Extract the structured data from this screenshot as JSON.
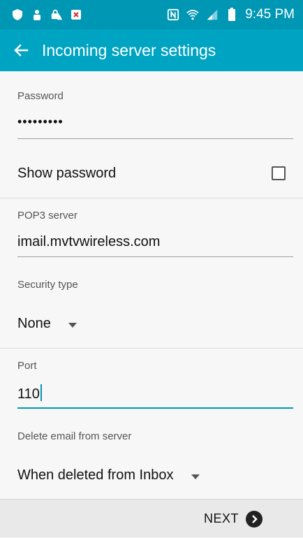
{
  "status_bar": {
    "time": "9:45 PM",
    "icons": [
      "shield-notification-icon",
      "person-notification-icon",
      "alert-notification-icon",
      "close-box-notification-icon",
      "nfc-icon",
      "wifi-icon",
      "signal-icon",
      "battery-icon"
    ]
  },
  "app_bar": {
    "title": "Incoming server settings",
    "back_icon": "arrow-left-icon"
  },
  "form": {
    "password": {
      "label": "Password",
      "value": "•••••••••"
    },
    "show_password": {
      "label": "Show password",
      "checked": false
    },
    "server": {
      "label": "POP3 server",
      "value": "imail.mvtvwireless.com"
    },
    "security_type": {
      "label": "Security type",
      "selected": "None"
    },
    "port": {
      "label": "Port",
      "value": "110"
    },
    "delete_email": {
      "label": "Delete email from server",
      "selected": "When deleted from Inbox"
    }
  },
  "footer": {
    "next_label": "NEXT",
    "next_icon": "chevron-right-circle-icon"
  },
  "colors": {
    "status_bar": "#0097b5",
    "app_bar": "#00a4c3",
    "accent": "#0097b5"
  }
}
